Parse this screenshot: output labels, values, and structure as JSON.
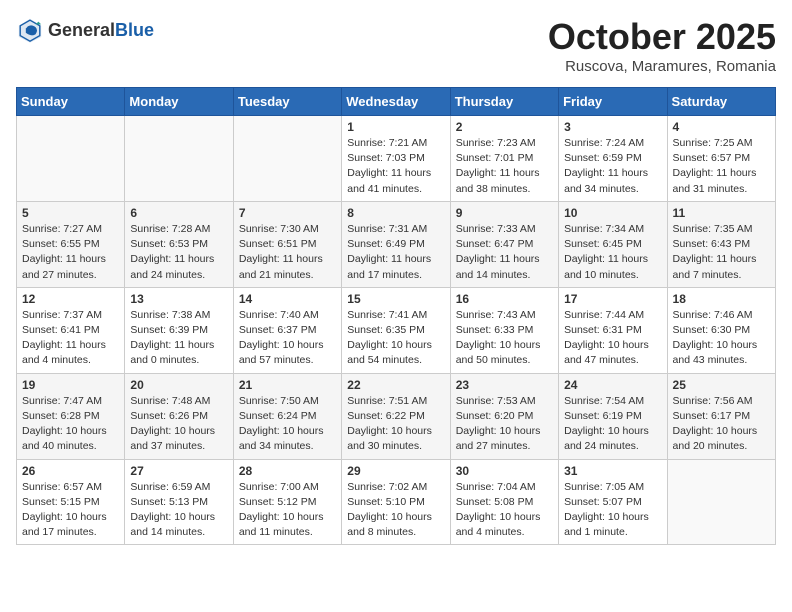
{
  "header": {
    "logo_general": "General",
    "logo_blue": "Blue",
    "month_title": "October 2025",
    "subtitle": "Ruscova, Maramures, Romania"
  },
  "days_of_week": [
    "Sunday",
    "Monday",
    "Tuesday",
    "Wednesday",
    "Thursday",
    "Friday",
    "Saturday"
  ],
  "weeks": [
    [
      {
        "day": "",
        "info": ""
      },
      {
        "day": "",
        "info": ""
      },
      {
        "day": "",
        "info": ""
      },
      {
        "day": "1",
        "info": "Sunrise: 7:21 AM\nSunset: 7:03 PM\nDaylight: 11 hours and 41 minutes."
      },
      {
        "day": "2",
        "info": "Sunrise: 7:23 AM\nSunset: 7:01 PM\nDaylight: 11 hours and 38 minutes."
      },
      {
        "day": "3",
        "info": "Sunrise: 7:24 AM\nSunset: 6:59 PM\nDaylight: 11 hours and 34 minutes."
      },
      {
        "day": "4",
        "info": "Sunrise: 7:25 AM\nSunset: 6:57 PM\nDaylight: 11 hours and 31 minutes."
      }
    ],
    [
      {
        "day": "5",
        "info": "Sunrise: 7:27 AM\nSunset: 6:55 PM\nDaylight: 11 hours and 27 minutes."
      },
      {
        "day": "6",
        "info": "Sunrise: 7:28 AM\nSunset: 6:53 PM\nDaylight: 11 hours and 24 minutes."
      },
      {
        "day": "7",
        "info": "Sunrise: 7:30 AM\nSunset: 6:51 PM\nDaylight: 11 hours and 21 minutes."
      },
      {
        "day": "8",
        "info": "Sunrise: 7:31 AM\nSunset: 6:49 PM\nDaylight: 11 hours and 17 minutes."
      },
      {
        "day": "9",
        "info": "Sunrise: 7:33 AM\nSunset: 6:47 PM\nDaylight: 11 hours and 14 minutes."
      },
      {
        "day": "10",
        "info": "Sunrise: 7:34 AM\nSunset: 6:45 PM\nDaylight: 11 hours and 10 minutes."
      },
      {
        "day": "11",
        "info": "Sunrise: 7:35 AM\nSunset: 6:43 PM\nDaylight: 11 hours and 7 minutes."
      }
    ],
    [
      {
        "day": "12",
        "info": "Sunrise: 7:37 AM\nSunset: 6:41 PM\nDaylight: 11 hours and 4 minutes."
      },
      {
        "day": "13",
        "info": "Sunrise: 7:38 AM\nSunset: 6:39 PM\nDaylight: 11 hours and 0 minutes."
      },
      {
        "day": "14",
        "info": "Sunrise: 7:40 AM\nSunset: 6:37 PM\nDaylight: 10 hours and 57 minutes."
      },
      {
        "day": "15",
        "info": "Sunrise: 7:41 AM\nSunset: 6:35 PM\nDaylight: 10 hours and 54 minutes."
      },
      {
        "day": "16",
        "info": "Sunrise: 7:43 AM\nSunset: 6:33 PM\nDaylight: 10 hours and 50 minutes."
      },
      {
        "day": "17",
        "info": "Sunrise: 7:44 AM\nSunset: 6:31 PM\nDaylight: 10 hours and 47 minutes."
      },
      {
        "day": "18",
        "info": "Sunrise: 7:46 AM\nSunset: 6:30 PM\nDaylight: 10 hours and 43 minutes."
      }
    ],
    [
      {
        "day": "19",
        "info": "Sunrise: 7:47 AM\nSunset: 6:28 PM\nDaylight: 10 hours and 40 minutes."
      },
      {
        "day": "20",
        "info": "Sunrise: 7:48 AM\nSunset: 6:26 PM\nDaylight: 10 hours and 37 minutes."
      },
      {
        "day": "21",
        "info": "Sunrise: 7:50 AM\nSunset: 6:24 PM\nDaylight: 10 hours and 34 minutes."
      },
      {
        "day": "22",
        "info": "Sunrise: 7:51 AM\nSunset: 6:22 PM\nDaylight: 10 hours and 30 minutes."
      },
      {
        "day": "23",
        "info": "Sunrise: 7:53 AM\nSunset: 6:20 PM\nDaylight: 10 hours and 27 minutes."
      },
      {
        "day": "24",
        "info": "Sunrise: 7:54 AM\nSunset: 6:19 PM\nDaylight: 10 hours and 24 minutes."
      },
      {
        "day": "25",
        "info": "Sunrise: 7:56 AM\nSunset: 6:17 PM\nDaylight: 10 hours and 20 minutes."
      }
    ],
    [
      {
        "day": "26",
        "info": "Sunrise: 6:57 AM\nSunset: 5:15 PM\nDaylight: 10 hours and 17 minutes."
      },
      {
        "day": "27",
        "info": "Sunrise: 6:59 AM\nSunset: 5:13 PM\nDaylight: 10 hours and 14 minutes."
      },
      {
        "day": "28",
        "info": "Sunrise: 7:00 AM\nSunset: 5:12 PM\nDaylight: 10 hours and 11 minutes."
      },
      {
        "day": "29",
        "info": "Sunrise: 7:02 AM\nSunset: 5:10 PM\nDaylight: 10 hours and 8 minutes."
      },
      {
        "day": "30",
        "info": "Sunrise: 7:04 AM\nSunset: 5:08 PM\nDaylight: 10 hours and 4 minutes."
      },
      {
        "day": "31",
        "info": "Sunrise: 7:05 AM\nSunset: 5:07 PM\nDaylight: 10 hours and 1 minute."
      },
      {
        "day": "",
        "info": ""
      }
    ]
  ]
}
